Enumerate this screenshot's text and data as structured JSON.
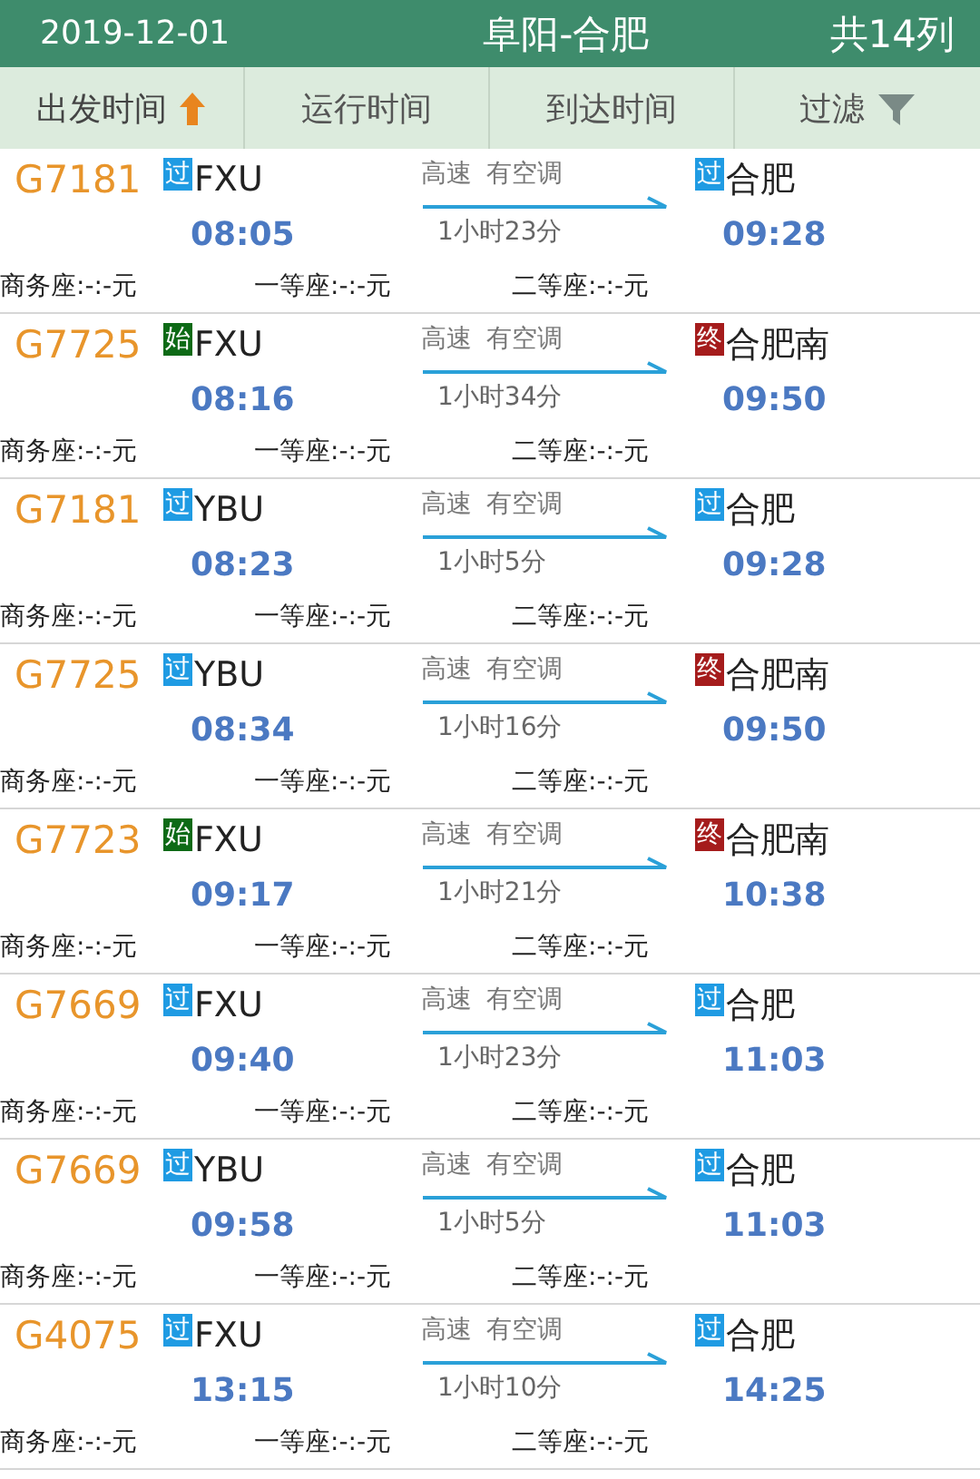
{
  "header": {
    "date": "2019-12-01",
    "route": "阜阳-合肥",
    "count": "共14列"
  },
  "columns": [
    {
      "label": "出发时间",
      "kind": "sort",
      "sorted": true
    },
    {
      "label": "运行时间",
      "kind": "sort",
      "sorted": false
    },
    {
      "label": "到达时间",
      "kind": "sort",
      "sorted": false
    },
    {
      "label": "过滤",
      "kind": "filter",
      "sorted": false
    }
  ],
  "rows": [
    {
      "train": "G7181",
      "from": {
        "badge": "过",
        "kind": "pass",
        "station": "FXU"
      },
      "depart": "08:05",
      "tags": [
        "高速",
        "有空调"
      ],
      "duration": "1小时23分",
      "to": {
        "badge": "过",
        "kind": "pass",
        "station": "合肥"
      },
      "arrive": "09:28",
      "seats": [
        "商务座:-:-元",
        "一等座:-:-元",
        "二等座:-:-元"
      ]
    },
    {
      "train": "G7725",
      "from": {
        "badge": "始",
        "kind": "start",
        "station": "FXU"
      },
      "depart": "08:16",
      "tags": [
        "高速",
        "有空调"
      ],
      "duration": "1小时34分",
      "to": {
        "badge": "终",
        "kind": "end",
        "station": "合肥南"
      },
      "arrive": "09:50",
      "seats": [
        "商务座:-:-元",
        "一等座:-:-元",
        "二等座:-:-元"
      ]
    },
    {
      "train": "G7181",
      "from": {
        "badge": "过",
        "kind": "pass",
        "station": "YBU"
      },
      "depart": "08:23",
      "tags": [
        "高速",
        "有空调"
      ],
      "duration": "1小时5分",
      "to": {
        "badge": "过",
        "kind": "pass",
        "station": "合肥"
      },
      "arrive": "09:28",
      "seats": [
        "商务座:-:-元",
        "一等座:-:-元",
        "二等座:-:-元"
      ]
    },
    {
      "train": "G7725",
      "from": {
        "badge": "过",
        "kind": "pass",
        "station": "YBU"
      },
      "depart": "08:34",
      "tags": [
        "高速",
        "有空调"
      ],
      "duration": "1小时16分",
      "to": {
        "badge": "终",
        "kind": "end",
        "station": "合肥南"
      },
      "arrive": "09:50",
      "seats": [
        "商务座:-:-元",
        "一等座:-:-元",
        "二等座:-:-元"
      ]
    },
    {
      "train": "G7723",
      "from": {
        "badge": "始",
        "kind": "start",
        "station": "FXU"
      },
      "depart": "09:17",
      "tags": [
        "高速",
        "有空调"
      ],
      "duration": "1小时21分",
      "to": {
        "badge": "终",
        "kind": "end",
        "station": "合肥南"
      },
      "arrive": "10:38",
      "seats": [
        "商务座:-:-元",
        "一等座:-:-元",
        "二等座:-:-元"
      ]
    },
    {
      "train": "G7669",
      "from": {
        "badge": "过",
        "kind": "pass",
        "station": "FXU"
      },
      "depart": "09:40",
      "tags": [
        "高速",
        "有空调"
      ],
      "duration": "1小时23分",
      "to": {
        "badge": "过",
        "kind": "pass",
        "station": "合肥"
      },
      "arrive": "11:03",
      "seats": [
        "商务座:-:-元",
        "一等座:-:-元",
        "二等座:-:-元"
      ]
    },
    {
      "train": "G7669",
      "from": {
        "badge": "过",
        "kind": "pass",
        "station": "YBU"
      },
      "depart": "09:58",
      "tags": [
        "高速",
        "有空调"
      ],
      "duration": "1小时5分",
      "to": {
        "badge": "过",
        "kind": "pass",
        "station": "合肥"
      },
      "arrive": "11:03",
      "seats": [
        "商务座:-:-元",
        "一等座:-:-元",
        "二等座:-:-元"
      ]
    },
    {
      "train": "G4075",
      "from": {
        "badge": "过",
        "kind": "pass",
        "station": "FXU"
      },
      "depart": "13:15",
      "tags": [
        "高速",
        "有空调"
      ],
      "duration": "1小时10分",
      "to": {
        "badge": "过",
        "kind": "pass",
        "station": "合肥"
      },
      "arrive": "14:25",
      "seats": [
        "商务座:-:-元",
        "一等座:-:-元",
        "二等座:-:-元"
      ]
    }
  ]
}
